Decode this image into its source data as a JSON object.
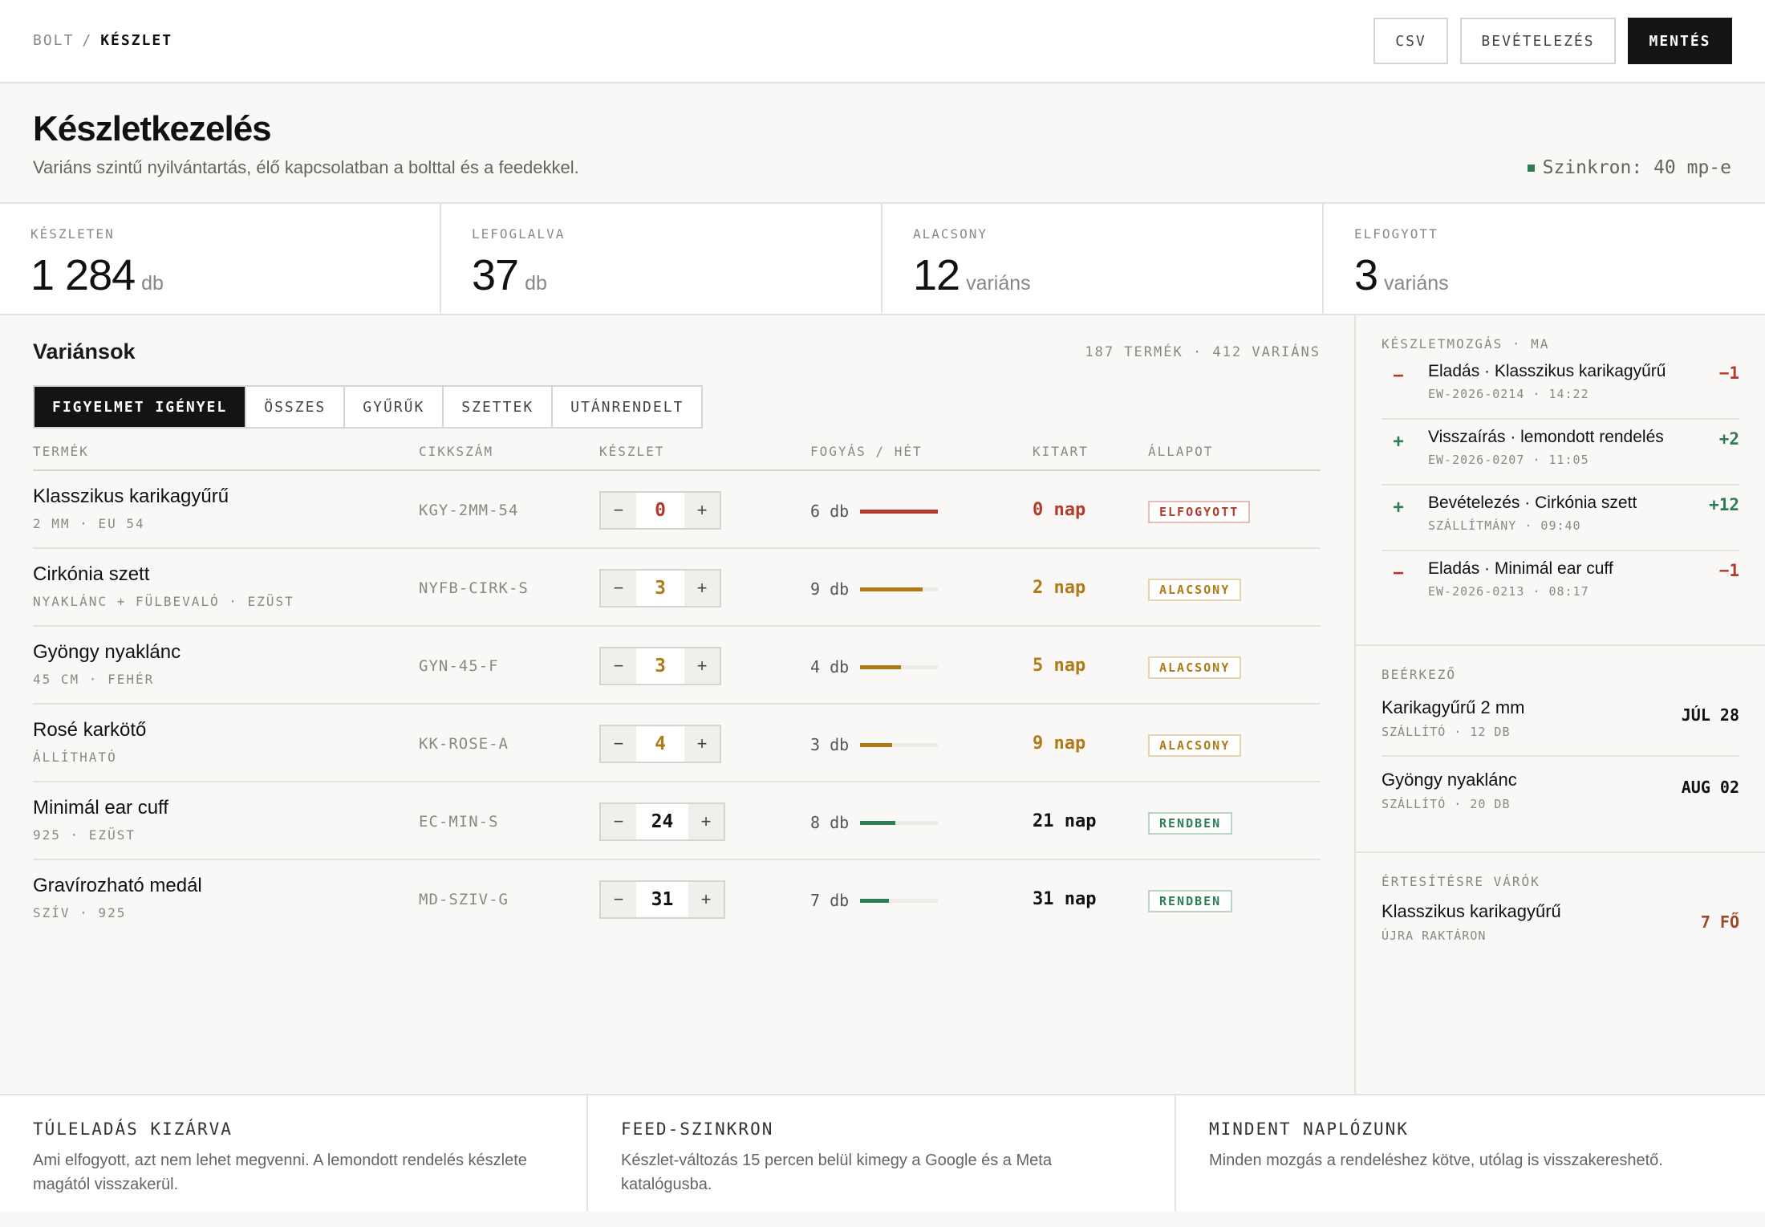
{
  "breadcrumb": {
    "root": "BOLT",
    "separator": "/",
    "current": "KÉSZLET"
  },
  "actions": {
    "csv": "CSV",
    "receive": "BEVÉTELEZÉS",
    "save": "MENTÉS"
  },
  "header": {
    "title": "Készletkezelés",
    "subtitle": "Variáns szintű nyilvántartás, élő kapcsolatban a bolttal és a feedekkel.",
    "sync": "Szinkron: 40 mp-e"
  },
  "stats": [
    {
      "label": "KÉSZLETEN",
      "value": "1 284",
      "unit": "db",
      "color": "#111111"
    },
    {
      "label": "LEFOGLALVA",
      "value": "37",
      "unit": "db",
      "color": "#111111"
    },
    {
      "label": "ALACSONY",
      "value": "12",
      "unit": "variáns",
      "color": "#b07a17"
    },
    {
      "label": "ELFOGYOTT",
      "value": "3",
      "unit": "variáns",
      "color": "#b23b2b"
    }
  ],
  "variants": {
    "title": "Variánsok",
    "count": "187 TERMÉK · 412 VARIÁNS",
    "tabs": [
      "FIGYELMET IGÉNYEL",
      "ÖSSZES",
      "GYŰRŰK",
      "SZETTEK",
      "UTÁNRENDELT"
    ],
    "columns": {
      "product": "TERMÉK",
      "sku": "CIKKSZÁM",
      "stock": "KÉSZLET",
      "sales": "FOGYÁS / HÉT",
      "lasts": "KITART",
      "status": "ÁLLAPOT"
    },
    "rows": [
      {
        "name": "Klasszikus karikagyűrű",
        "meta": "2 MM · EU 54",
        "sku": "KGY-2MM-54",
        "stock": "0",
        "sales": "6 db",
        "sales_fraction": 1.0,
        "lasts": "0 nap",
        "status": "ELFOGYOTT",
        "level": "red"
      },
      {
        "name": "Cirkónia szett",
        "meta": "NYAKLÁNC + FÜLBEVALÓ · EZÜST",
        "sku": "NYFB-CIRK-S",
        "stock": "3",
        "sales": "9 db",
        "sales_fraction": 0.8,
        "lasts": "2 nap",
        "status": "ALACSONY",
        "level": "amber"
      },
      {
        "name": "Gyöngy nyaklánc",
        "meta": "45 CM · FEHÉR",
        "sku": "GYN-45-F",
        "stock": "3",
        "sales": "4 db",
        "sales_fraction": 0.52,
        "lasts": "5 nap",
        "status": "ALACSONY",
        "level": "amber"
      },
      {
        "name": "Rosé karkötő",
        "meta": "ÁLLÍTHATÓ",
        "sku": "KK-ROSE-A",
        "stock": "4",
        "sales": "3 db",
        "sales_fraction": 0.41,
        "lasts": "9 nap",
        "status": "ALACSONY",
        "level": "amber"
      },
      {
        "name": "Minimál ear cuff",
        "meta": "925 · EZÜST",
        "sku": "EC-MIN-S",
        "stock": "24",
        "sales": "8 db",
        "sales_fraction": 0.45,
        "lasts": "21 nap",
        "status": "RENDBEN",
        "level": "green"
      },
      {
        "name": "Gravírozható medál",
        "meta": "SZÍV · 925",
        "sku": "MD-SZIV-G",
        "stock": "31",
        "sales": "7 db",
        "sales_fraction": 0.37,
        "lasts": "31 nap",
        "status": "RENDBEN",
        "level": "green"
      }
    ]
  },
  "movements": {
    "label": "KÉSZLETMOZGÁS · MA",
    "items": [
      {
        "sign": "−",
        "title": "Eladás · Klasszikus karikagyűrű",
        "meta": "EW-2026-0214 · 14:22",
        "delta": "−1",
        "level": "red"
      },
      {
        "sign": "+",
        "title": "Visszaírás · lemondott rendelés",
        "meta": "EW-2026-0207 · 11:05",
        "delta": "+2",
        "level": "green"
      },
      {
        "sign": "+",
        "title": "Bevételezés · Cirkónia szett",
        "meta": "SZÁLLÍTMÁNY · 09:40",
        "delta": "+12",
        "level": "green"
      },
      {
        "sign": "−",
        "title": "Eladás · Minimál ear cuff",
        "meta": "EW-2026-0213 · 08:17",
        "delta": "−1",
        "level": "red"
      }
    ]
  },
  "incoming": {
    "label": "BEÉRKEZŐ",
    "items": [
      {
        "title": "Karikagyűrű 2 mm",
        "meta": "SZÁLLÍTÓ · 12 DB",
        "date": "JÚL 28"
      },
      {
        "title": "Gyöngy nyaklánc",
        "meta": "SZÁLLÍTÓ · 20 DB",
        "date": "AUG 02"
      }
    ]
  },
  "waiting": {
    "label": "ÉRTESÍTÉSRE VÁRÓK",
    "items": [
      {
        "title": "Klasszikus karikagyűrű",
        "meta": "ÚJRA RAKTÁRON",
        "count": "7 FŐ"
      }
    ]
  },
  "footer": [
    {
      "title": "TÚLELADÁS KIZÁRVA",
      "text": "Ami elfogyott, azt nem lehet megvenni. A lemondott rendelés készlete magától visszakerül."
    },
    {
      "title": "FEED-SZINKRON",
      "text": "Készlet-változás 15 percen belül kimegy a Google és a Meta katalógusba."
    },
    {
      "title": "MINDENT NAPLÓZUNK",
      "text": "Minden mozgás a rendeléshez kötve, utólag is visszakereshető."
    }
  ],
  "colors": {
    "red": "#b23b2b",
    "amber": "#b07a17",
    "green": "#2f7d55",
    "dark": "#111111"
  },
  "icons": {
    "minus": "minus-icon",
    "plus": "plus-icon",
    "sync": "sync-status-dot"
  }
}
